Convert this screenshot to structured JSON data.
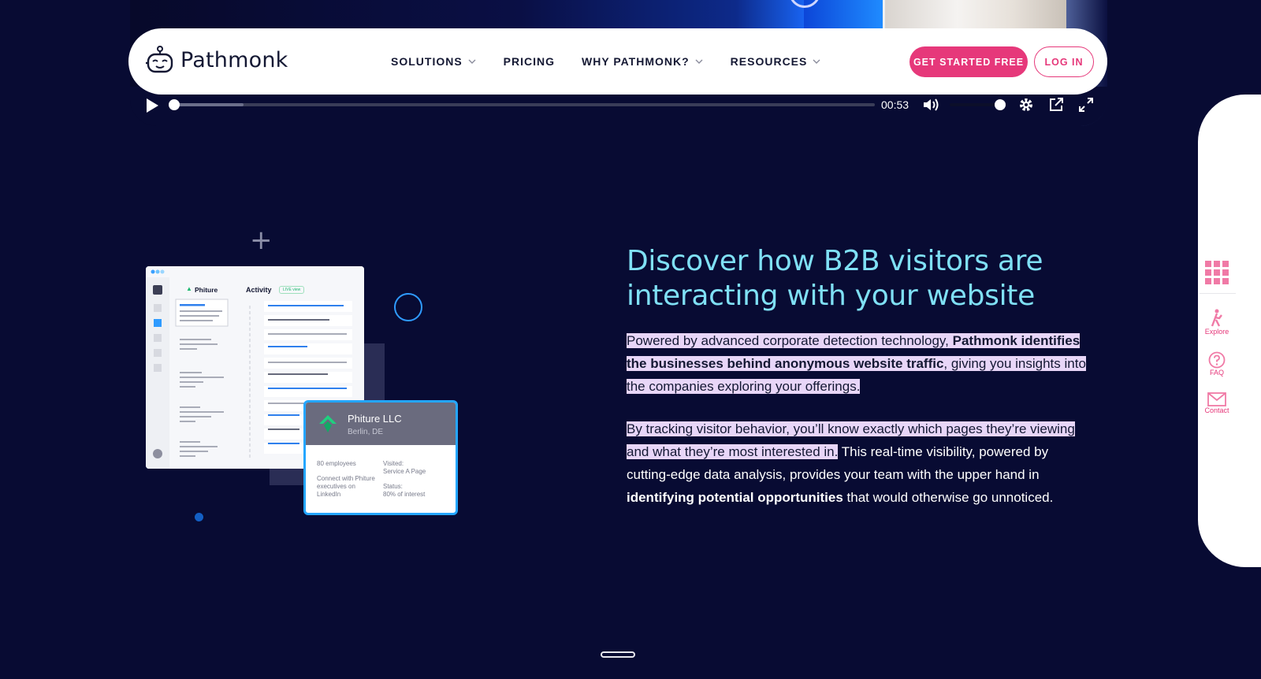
{
  "brand": {
    "name": "Pathmonk",
    "accent": "#e6387a",
    "headline_color": "#7fe0f5"
  },
  "nav": {
    "items": [
      {
        "label": "SOLUTIONS",
        "has_dropdown": true
      },
      {
        "label": "PRICING",
        "has_dropdown": false
      },
      {
        "label": "WHY PATHMONK?",
        "has_dropdown": true
      },
      {
        "label": "RESOURCES",
        "has_dropdown": true
      }
    ],
    "cta_label": "GET STARTED FREE",
    "login_label": "LOG IN"
  },
  "video": {
    "time": "00:53",
    "progress_fraction": 0.1,
    "volume_fraction": 0.95
  },
  "side_panel": {
    "explore": "Explore",
    "faq": "FAQ",
    "contact": "Contact"
  },
  "illustration": {
    "app_brand": "Phiture",
    "activity_label": "Activity",
    "live_badge": "LIVE view",
    "company_name": "Phiture LLC",
    "company_location": "Berlin, DE",
    "employees": "80 employees",
    "connect_text": "Connect with Phiture executives on LinkedIn",
    "visited_label": "Visited:",
    "visited_value": "Service A Page",
    "status_label": "Status:",
    "status_value": "80% of interest"
  },
  "content": {
    "headline": "Discover how B2B visitors are interacting with your website",
    "p1_hl_plain": "Powered by advanced corporate detection technology, ",
    "p1_hl_bold": "Pathmonk identifies the businesses behind anonymous website traffic",
    "p1_hl_rest": ", giving you insights into the companies exploring your offerings.",
    "p2_hl": "By tracking visitor behavior, you’ll know exactly which pages they’re viewing and what they’re most interested in.",
    "p2_plain": " This real-time visibility, powered by cutting-edge data analysis, provides your team with the upper hand in ",
    "p2_bold": "identifying potential opportunities",
    "p2_end": " that would otherwise go unnoticed."
  }
}
